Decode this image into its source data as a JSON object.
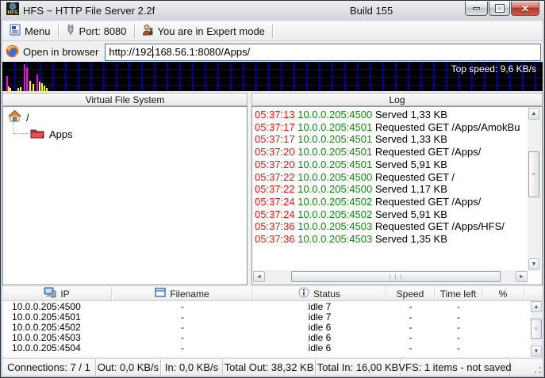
{
  "window": {
    "title": "HFS ~ HTTP File Server 2.2f",
    "build": "Build 155"
  },
  "toolbar": {
    "menu_label": "Menu",
    "port_label": "Port: 8080",
    "mode_label": "You are in Expert mode"
  },
  "address": {
    "open_label": "Open in browser",
    "url": "http://192.168.56.1:8080/Apps/"
  },
  "graph": {
    "top_speed_label": "Top speed: 9,6 KB/s",
    "spikes": [
      {
        "x": 5,
        "h": 19,
        "color": "m"
      },
      {
        "x": 7,
        "h": 6,
        "color": "y"
      },
      {
        "x": 9,
        "h": 4,
        "color": "y"
      },
      {
        "x": 19,
        "h": 4,
        "color": "y"
      },
      {
        "x": 22,
        "h": 5,
        "color": "y"
      },
      {
        "x": 27,
        "h": 34,
        "color": "m"
      },
      {
        "x": 30,
        "h": 30,
        "color": "m"
      },
      {
        "x": 34,
        "h": 13,
        "color": "y"
      },
      {
        "x": 38,
        "h": 9,
        "color": "y"
      },
      {
        "x": 43,
        "h": 21,
        "color": "m"
      },
      {
        "x": 46,
        "h": 12,
        "color": "y"
      },
      {
        "x": 49,
        "h": 10,
        "color": "y"
      },
      {
        "x": 52,
        "h": 7,
        "color": "y"
      },
      {
        "x": 55,
        "h": 4,
        "color": "y"
      }
    ]
  },
  "vfs": {
    "header": "Virtual File System",
    "root_label": "/",
    "items": [
      {
        "label": "Apps"
      }
    ]
  },
  "log": {
    "header": "Log",
    "entries": [
      {
        "time": "05:37:13",
        "ip": "10.0.0.205:4500",
        "message": "Served 1,33 KB"
      },
      {
        "time": "05:37:17",
        "ip": "10.0.0.205:4501",
        "message": "Requested GET /Apps/AmokBu"
      },
      {
        "time": "05:37:17",
        "ip": "10.0.0.205:4501",
        "message": "Served 1,33 KB"
      },
      {
        "time": "05:37:20",
        "ip": "10.0.0.205:4501",
        "message": "Requested GET /Apps/"
      },
      {
        "time": "05:37:20",
        "ip": "10.0.0.205:4501",
        "message": "Served 5,91 KB"
      },
      {
        "time": "05:37:22",
        "ip": "10.0.0.205:4500",
        "message": "Requested GET /"
      },
      {
        "time": "05:37:22",
        "ip": "10.0.0.205:4500",
        "message": "Served 1,17 KB"
      },
      {
        "time": "05:37:24",
        "ip": "10.0.0.205:4502",
        "message": "Requested GET /Apps/"
      },
      {
        "time": "05:37:24",
        "ip": "10.0.0.205:4502",
        "message": "Served 5,91 KB"
      },
      {
        "time": "05:37:36",
        "ip": "10.0.0.205:4503",
        "message": "Requested GET /Apps/HFS/"
      },
      {
        "time": "05:37:36",
        "ip": "10.0.0.205:4503",
        "message": "Served 1,35 KB"
      }
    ]
  },
  "connections": {
    "columns": [
      "IP",
      "Filename",
      "Status",
      "Speed",
      "Time left",
      "%"
    ],
    "rows": [
      {
        "ip": "10.0.0.205:4500",
        "filename": "-",
        "status": "idle 7",
        "speed": "-",
        "time_left": "-",
        "percent": ""
      },
      {
        "ip": "10.0.0.205:4501",
        "filename": "-",
        "status": "idle 7",
        "speed": "-",
        "time_left": "-",
        "percent": ""
      },
      {
        "ip": "10.0.0.205:4502",
        "filename": "-",
        "status": "idle 6",
        "speed": "-",
        "time_left": "-",
        "percent": ""
      },
      {
        "ip": "10.0.0.205:4503",
        "filename": "-",
        "status": "idle 6",
        "speed": "-",
        "time_left": "-",
        "percent": ""
      },
      {
        "ip": "10.0.0.205:4504",
        "filename": "-",
        "status": "idle 6",
        "speed": "-",
        "time_left": "-",
        "percent": ""
      }
    ]
  },
  "statusbar": {
    "panels": [
      "Connections: 7 / 1",
      "Out: 0,0 KB/s",
      "In: 0,0 KB/s",
      "Total Out: 38,32 KB",
      "Total In: 16,00 KB",
      "VFS: 1 items - not saved"
    ]
  },
  "colors": {
    "log_time": "#ff1111",
    "log_ip": "#0b8a0b",
    "graph_out": "#ff00ff",
    "graph_in": "#ffff00",
    "graph_grid": "#0000b0",
    "close_button": "#b03628",
    "focused_input_border": "#3c7fb1"
  }
}
